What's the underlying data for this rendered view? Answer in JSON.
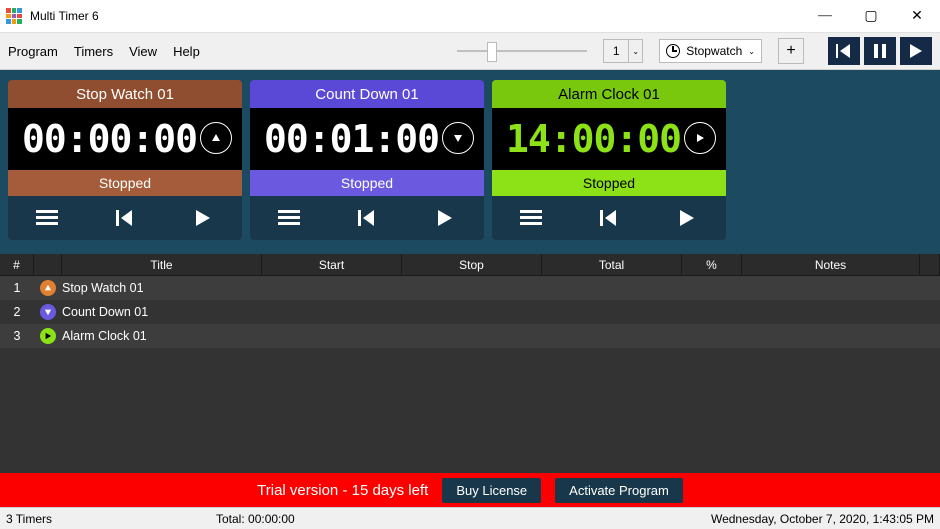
{
  "window": {
    "title": "Multi Timer 6"
  },
  "menu": {
    "program": "Program",
    "timers": "Timers",
    "view": "View",
    "help": "Help"
  },
  "toolbar": {
    "count": "1",
    "type": "Stopwatch",
    "plus": "+"
  },
  "cards": [
    {
      "title": "Stop Watch 01",
      "time": "00:00:00",
      "status": "Stopped",
      "kind": "up"
    },
    {
      "title": "Count Down 01",
      "time": "00:01:00",
      "status": "Stopped",
      "kind": "down"
    },
    {
      "title": "Alarm Clock 01",
      "time": "14:00:00",
      "status": "Stopped",
      "kind": "alarm"
    }
  ],
  "table": {
    "headers": {
      "num": "#",
      "title": "Title",
      "start": "Start",
      "stop": "Stop",
      "total": "Total",
      "pct": "%",
      "notes": "Notes"
    },
    "rows": [
      {
        "num": "1",
        "title": "Stop Watch 01",
        "kind": "up"
      },
      {
        "num": "2",
        "title": "Count Down 01",
        "kind": "down"
      },
      {
        "num": "3",
        "title": "Alarm Clock 01",
        "kind": "alarm"
      }
    ]
  },
  "trial": {
    "message": "Trial version - 15 days left",
    "buy": "Buy License",
    "activate": "Activate Program"
  },
  "status": {
    "count": "3 Timers",
    "total": "Total: 00:00:00",
    "datetime": "Wednesday, October 7, 2020, 1:43:05 PM"
  }
}
